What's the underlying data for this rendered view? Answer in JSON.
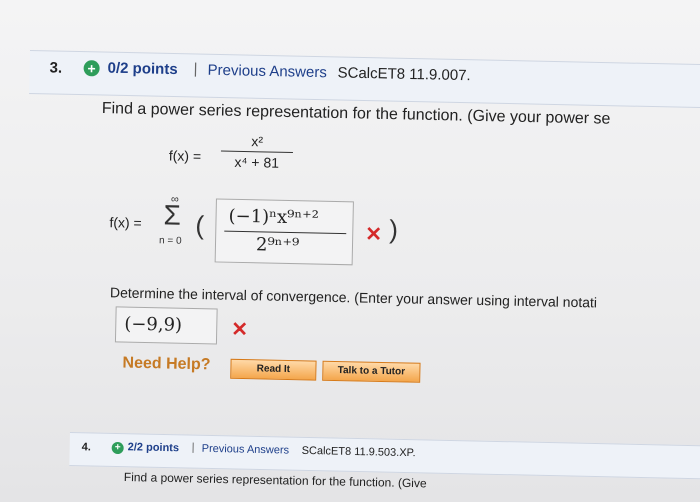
{
  "question3": {
    "number": "3.",
    "points": "0/2 points",
    "separator": "|",
    "previous_answers": "Previous Answers",
    "code": "SCalcET8 11.9.007.",
    "prompt": "Find a power series representation for the function. (Give your power se",
    "function_label": "f(x) =",
    "function_numerator": "x²",
    "function_denominator": "x⁴ + 81",
    "series_label": "f(x) =",
    "sigma_symbol": "Σ",
    "sigma_upper": "∞",
    "sigma_lower": "n = 0",
    "left_paren": "(",
    "right_paren": ")",
    "answer_numerator": "(−1)ⁿx⁹ⁿ⁺²",
    "answer_denominator": "2⁹ⁿ⁺⁹",
    "answer_status": "✕",
    "interval_prompt": "Determine the interval of convergence. (Enter your answer using interval notati",
    "interval_answer": "(−9,9)",
    "interval_status": "✕",
    "need_help": "Need Help?",
    "read_it": "Read It",
    "talk_to_tutor": "Talk to a Tutor"
  },
  "question4": {
    "number": "4.",
    "points": "2/2 points",
    "separator": "|",
    "previous_answers": "Previous Answers",
    "code": "SCalcET8 11.9.503.XP.",
    "prompt": "Find a power series representation for the function. (Give"
  },
  "colors": {
    "link": "#1e3f8a",
    "correct_badge": "#2e9d5a",
    "wrong_mark": "#d42a2a",
    "help_text": "#c67a24",
    "button_border": "#d77a18"
  },
  "icons": {
    "points_badge": "plus-circle-icon",
    "wrong": "x-mark-icon"
  }
}
